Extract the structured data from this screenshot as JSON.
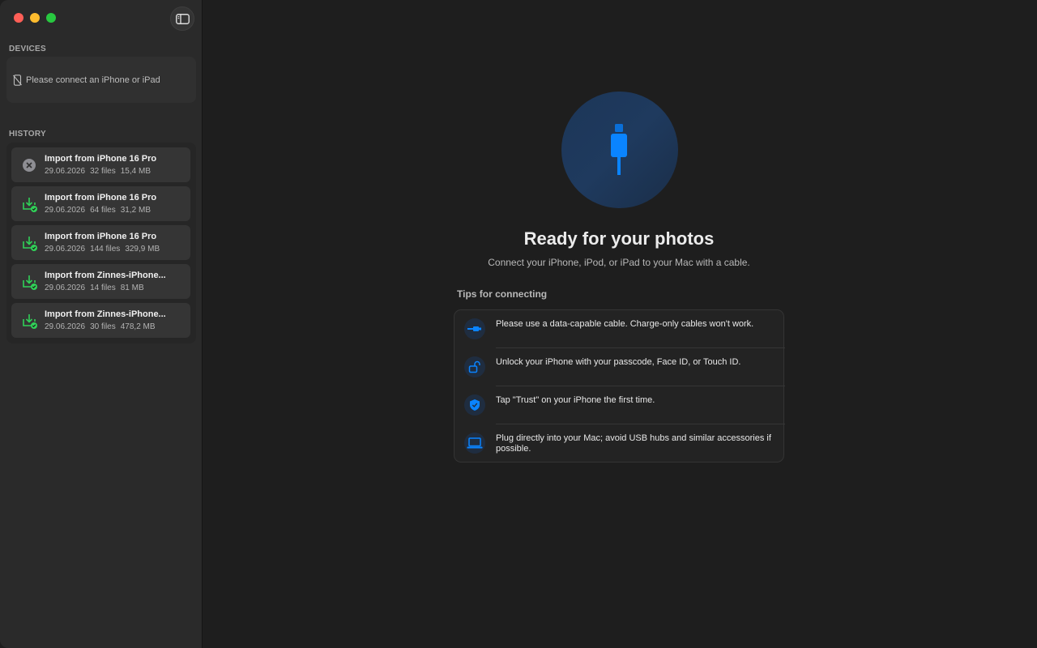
{
  "sidebar": {
    "devices_label": "DEVICES",
    "devices_empty": "Please connect an iPhone or iPad",
    "history_label": "HISTORY",
    "history": [
      {
        "title": "Import from iPhone 16 Pro",
        "date": "29.06.2026",
        "files": "32 files",
        "size": "15,4 MB",
        "status": "failed"
      },
      {
        "title": "Import from iPhone 16 Pro",
        "date": "29.06.2026",
        "files": "64 files",
        "size": "31,2 MB",
        "status": "success"
      },
      {
        "title": "Import from iPhone 16 Pro",
        "date": "29.06.2026",
        "files": "144 files",
        "size": "329,9 MB",
        "status": "success"
      },
      {
        "title": "Import from Zinnes-iPhone...",
        "date": "29.06.2026",
        "files": "14 files",
        "size": "81 MB",
        "status": "success"
      },
      {
        "title": "Import from Zinnes-iPhone...",
        "date": "29.06.2026",
        "files": "30 files",
        "size": "478,2 MB",
        "status": "success"
      }
    ]
  },
  "main": {
    "title": "Ready for your photos",
    "subtitle": "Connect your iPhone, iPod, or iPad to your Mac with a cable.",
    "tips_label": "Tips for connecting",
    "tips": [
      {
        "icon": "cable-icon",
        "text": "Please use a data-capable cable. Charge-only cables won't work."
      },
      {
        "icon": "unlock-icon",
        "text": "Unlock your iPhone with your passcode, Face ID, or Touch ID."
      },
      {
        "icon": "shield-check-icon",
        "text": "Tap \"Trust\" on your iPhone the first time."
      },
      {
        "icon": "laptop-icon",
        "text": "Plug directly into your Mac; avoid USB hubs and similar accessories if possible."
      }
    ]
  },
  "colors": {
    "accent": "#0a84ff",
    "success": "#30d158",
    "failed": "#8e8e93",
    "background": "#1e1e1e",
    "sidebar": "#2a2a2a"
  }
}
